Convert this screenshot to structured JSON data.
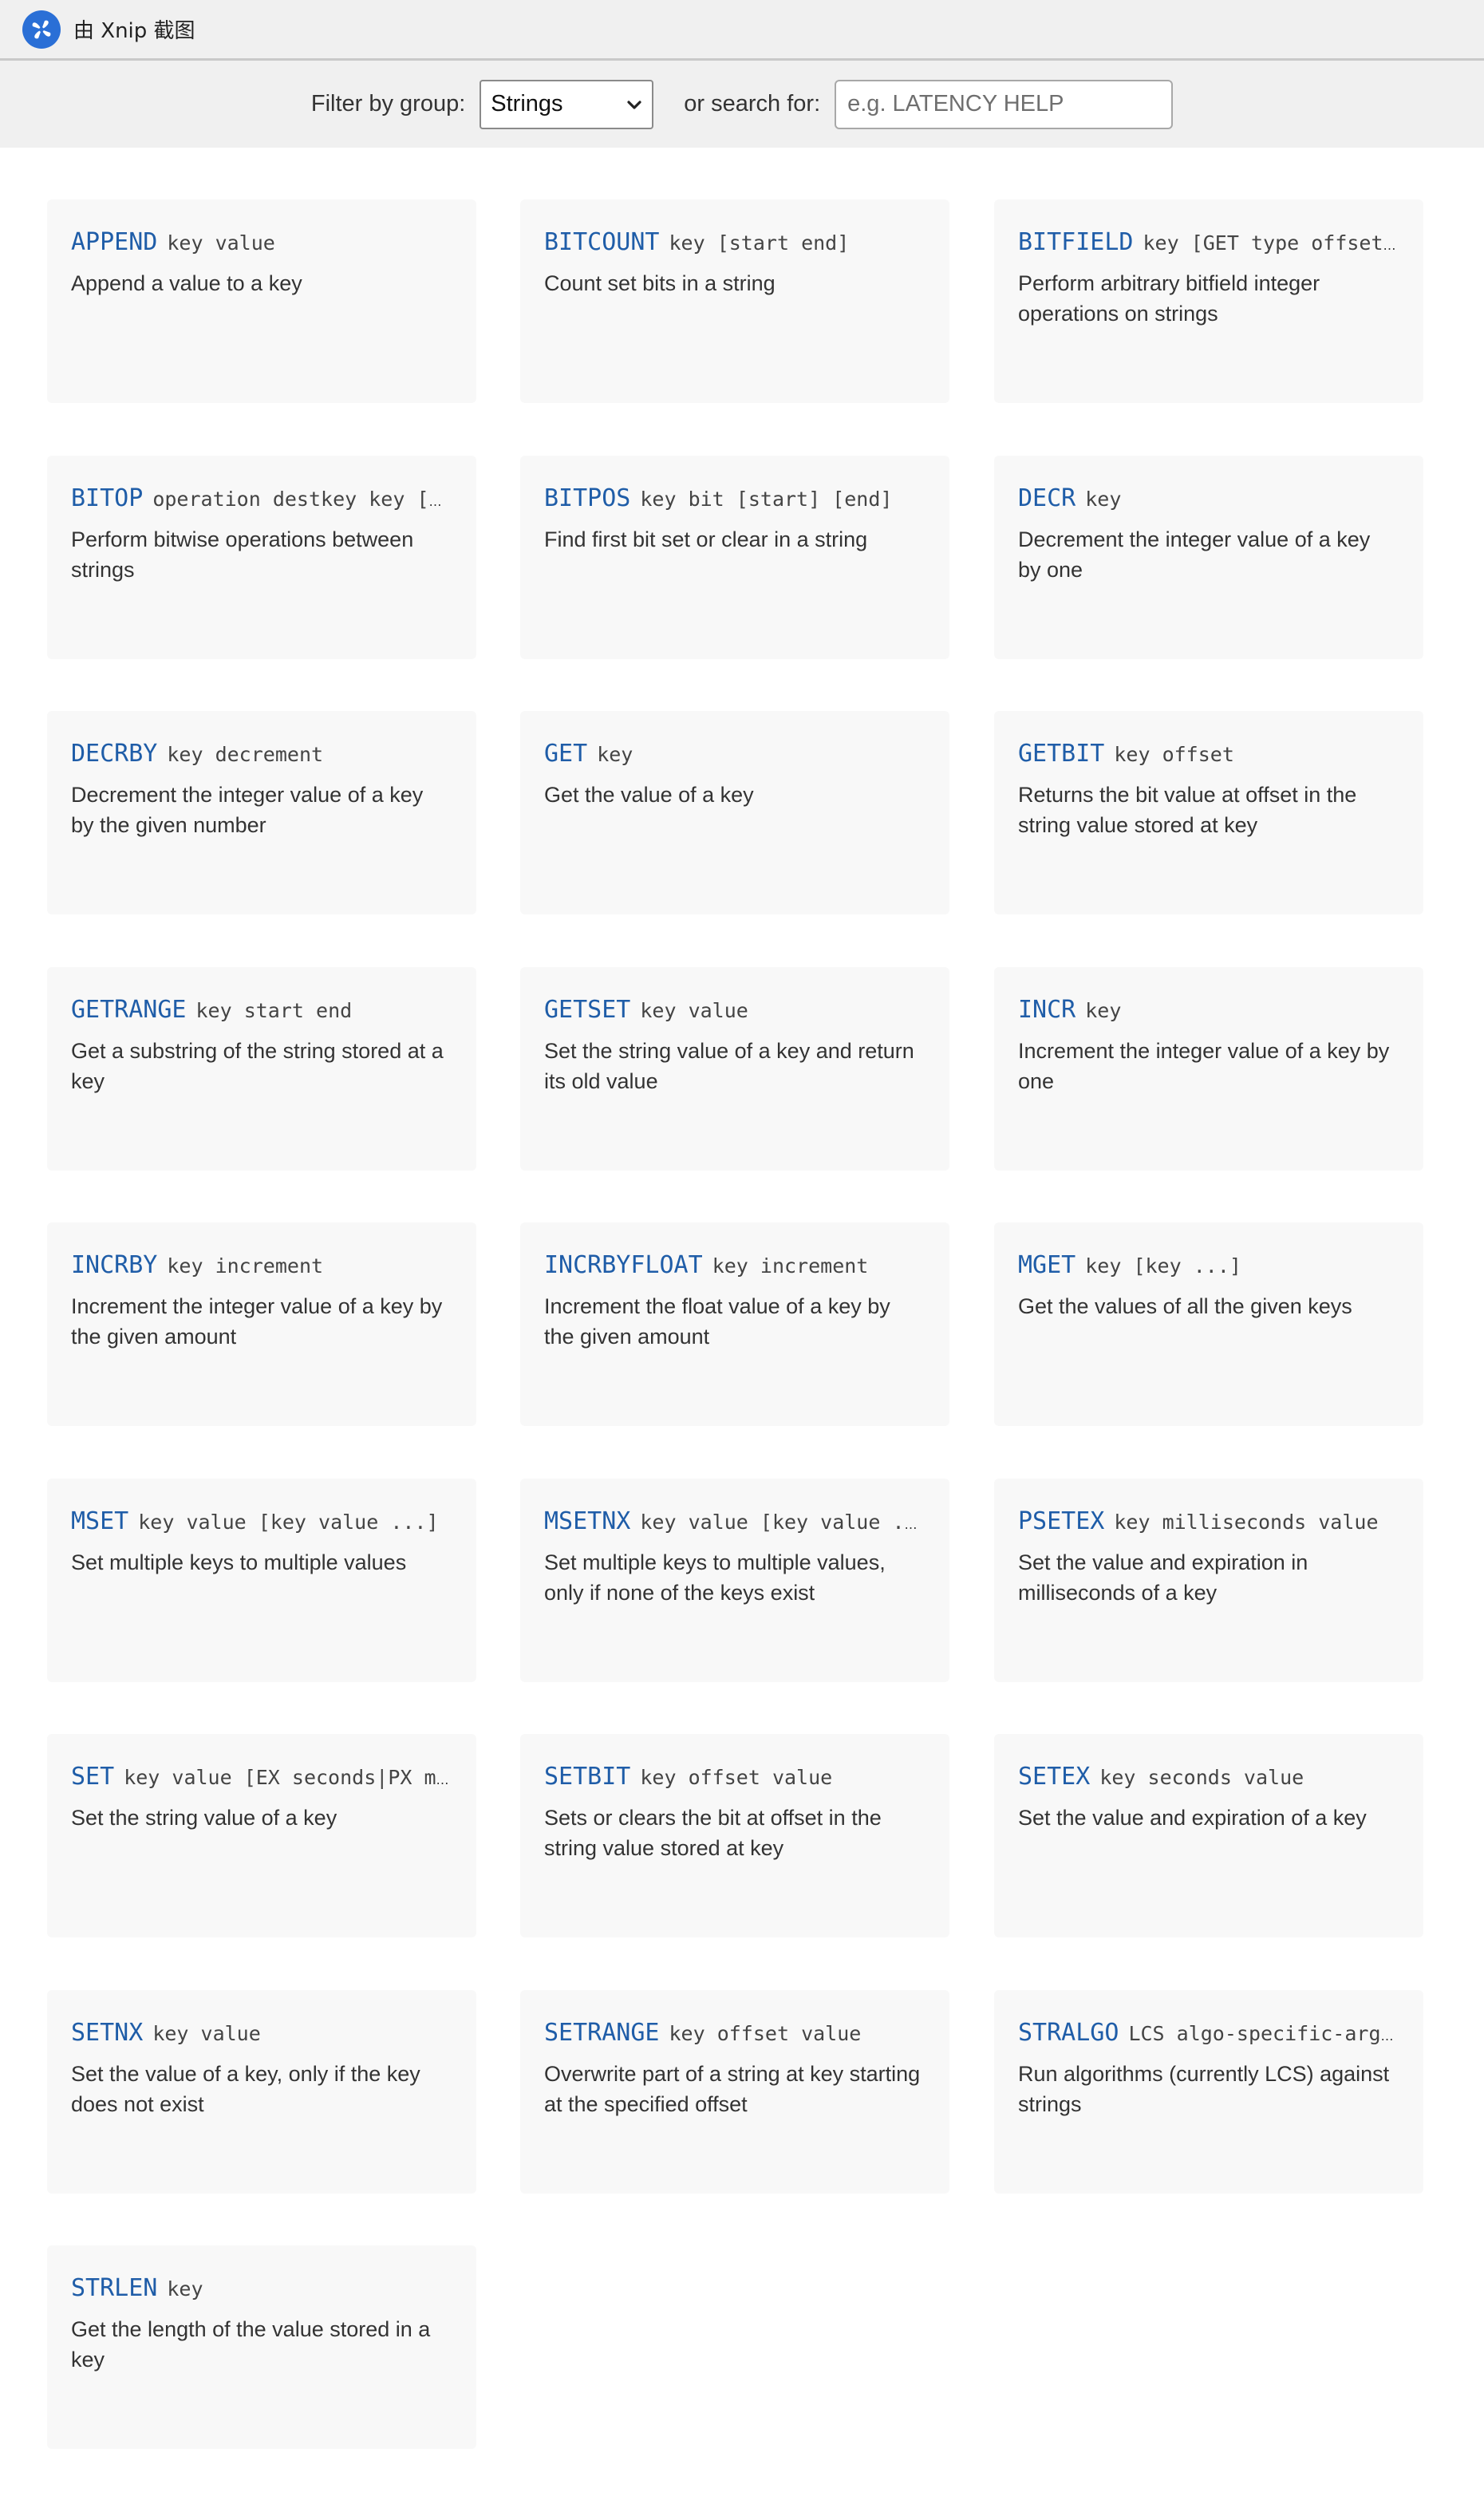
{
  "app": {
    "title": "由 Xnip 截图",
    "icon": "xnip-logo-icon"
  },
  "filter": {
    "group_label": "Filter by group:",
    "group_value": "Strings",
    "search_label": "or search for:",
    "search_placeholder": "e.g. LATENCY HELP",
    "search_value": ""
  },
  "commands": [
    {
      "name": "APPEND",
      "args": "key value",
      "desc": "Append a value to a key"
    },
    {
      "name": "BITCOUNT",
      "args": "key [start end]",
      "desc": "Count set bits in a string"
    },
    {
      "name": "BITFIELD",
      "args": "key [GET type offset]…",
      "desc": "Perform arbitrary bitfield integer operations on strings"
    },
    {
      "name": "BITOP",
      "args": "operation destkey key [k…",
      "desc": "Perform bitwise operations between strings"
    },
    {
      "name": "BITPOS",
      "args": "key bit [start] [end]",
      "desc": "Find first bit set or clear in a string"
    },
    {
      "name": "DECR",
      "args": "key",
      "desc": "Decrement the integer value of a key by one"
    },
    {
      "name": "DECRBY",
      "args": "key decrement",
      "desc": "Decrement the integer value of a key by the given number"
    },
    {
      "name": "GET",
      "args": "key",
      "desc": "Get the value of a key"
    },
    {
      "name": "GETBIT",
      "args": "key offset",
      "desc": "Returns the bit value at offset in the string value stored at key"
    },
    {
      "name": "GETRANGE",
      "args": "key start end",
      "desc": "Get a substring of the string stored at a key"
    },
    {
      "name": "GETSET",
      "args": "key value",
      "desc": "Set the string value of a key and return its old value"
    },
    {
      "name": "INCR",
      "args": "key",
      "desc": "Increment the integer value of a key by one"
    },
    {
      "name": "INCRBY",
      "args": "key increment",
      "desc": "Increment the integer value of a key by the given amount"
    },
    {
      "name": "INCRBYFLOAT",
      "args": "key increment",
      "desc": "Increment the float value of a key by the given amount"
    },
    {
      "name": "MGET",
      "args": "key [key ...]",
      "desc": "Get the values of all the given keys"
    },
    {
      "name": "MSET",
      "args": "key value [key value ...]",
      "desc": "Set multiple keys to multiple values"
    },
    {
      "name": "MSETNX",
      "args": "key value [key value ...…",
      "desc": "Set multiple keys to multiple values, only if none of the keys exist"
    },
    {
      "name": "PSETEX",
      "args": "key milliseconds value",
      "desc": "Set the value and expiration in milliseconds of a key"
    },
    {
      "name": "SET",
      "args": "key value [EX seconds|PX mi…",
      "desc": "Set the string value of a key"
    },
    {
      "name": "SETBIT",
      "args": "key offset value",
      "desc": "Sets or clears the bit at offset in the string value stored at key"
    },
    {
      "name": "SETEX",
      "args": "key seconds value",
      "desc": "Set the value and expiration of a key"
    },
    {
      "name": "SETNX",
      "args": "key value",
      "desc": "Set the value of a key, only if the key does not exist"
    },
    {
      "name": "SETRANGE",
      "args": "key offset value",
      "desc": "Overwrite part of a string at key starting at the specified offset"
    },
    {
      "name": "STRALGO",
      "args": "LCS algo-specific-argu…",
      "desc": "Run algorithms (currently LCS) against strings"
    },
    {
      "name": "STRLEN",
      "args": "key",
      "desc": "Get the length of the value stored in a key"
    }
  ]
}
